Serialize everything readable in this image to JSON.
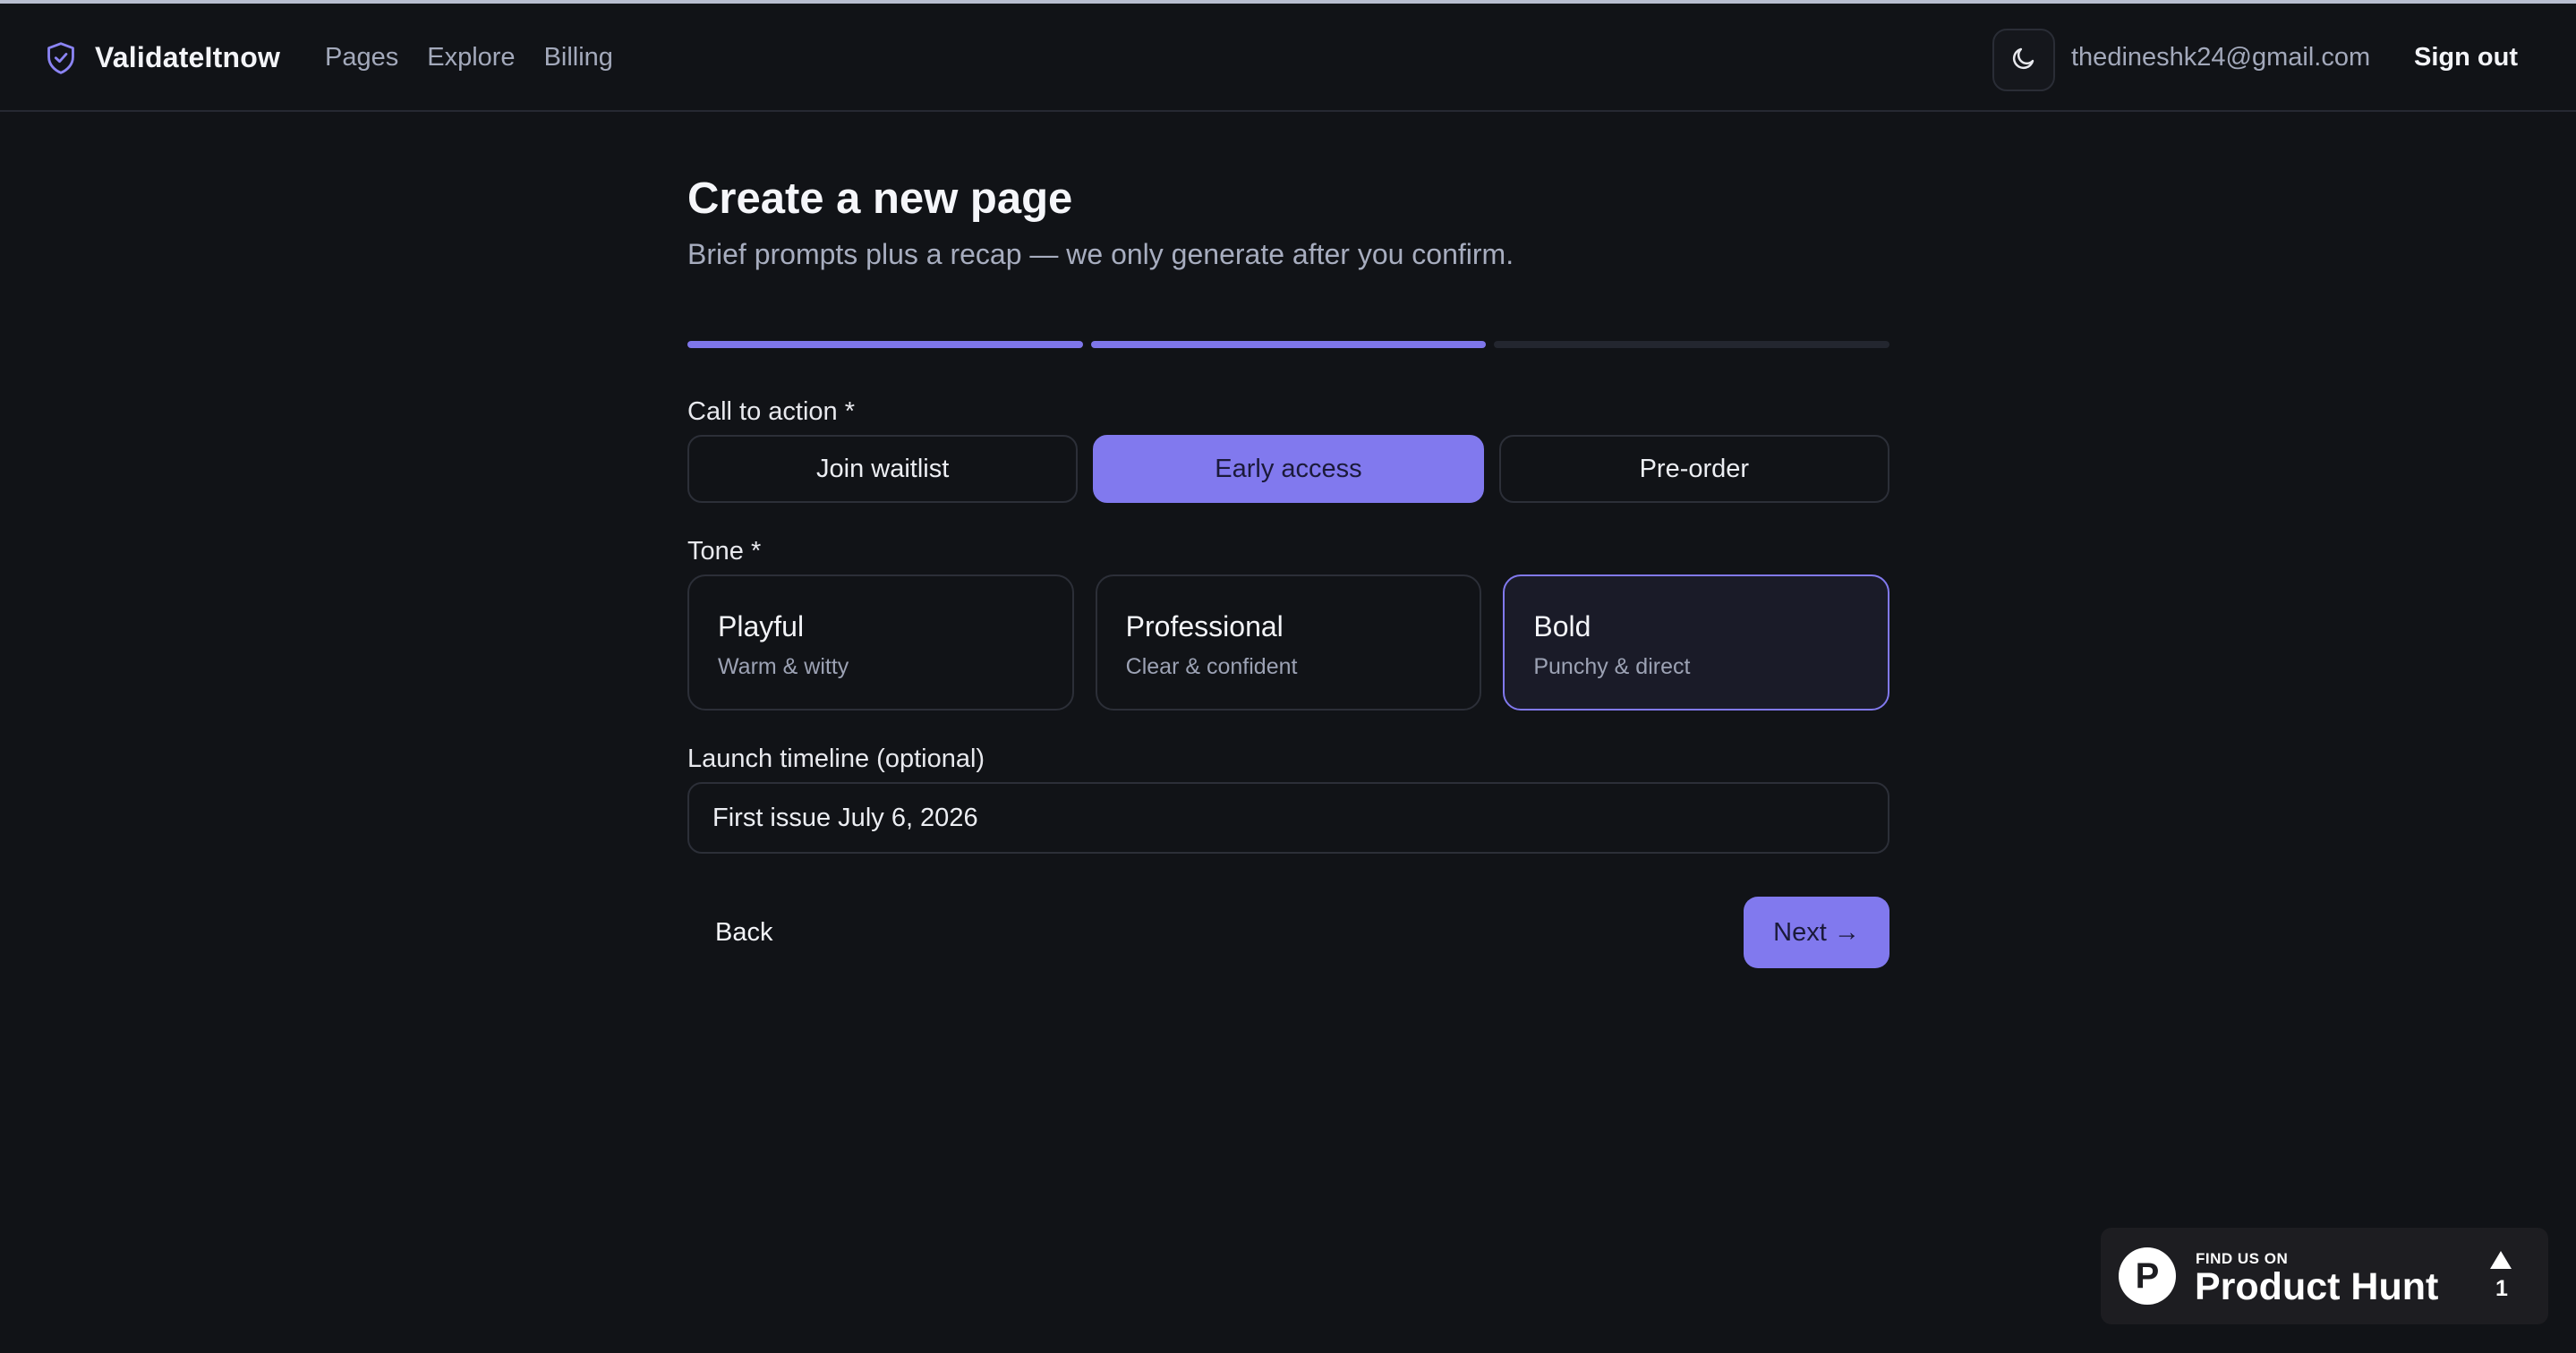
{
  "header": {
    "brand": "ValidateItnow",
    "nav": [
      "Pages",
      "Explore",
      "Billing"
    ],
    "email": "thedineshk24@gmail.com",
    "sign_out": "Sign out"
  },
  "page": {
    "title": "Create a new page",
    "subtitle": "Brief prompts plus a recap — we only generate after you confirm.",
    "progress": {
      "current_step": 2,
      "total_steps": 3
    }
  },
  "form": {
    "cta_label": "Call to action *",
    "cta_options": [
      "Join waitlist",
      "Early access",
      "Pre-order"
    ],
    "cta_selected": "Early access",
    "tone_label": "Tone *",
    "tone_options": [
      {
        "title": "Playful",
        "desc": "Warm & witty"
      },
      {
        "title": "Professional",
        "desc": "Clear & confident"
      },
      {
        "title": "Bold",
        "desc": "Punchy & direct"
      }
    ],
    "tone_selected": "Bold",
    "timeline_label": "Launch timeline (optional)",
    "timeline_value": "First issue July 6, 2026",
    "back": "Back",
    "next": "Next →"
  },
  "product_hunt": {
    "small": "FIND US ON",
    "big": "Product Hunt",
    "logo_letter": "P",
    "count": "1"
  },
  "colors": {
    "accent": "#8179ee",
    "background": "#111317"
  }
}
